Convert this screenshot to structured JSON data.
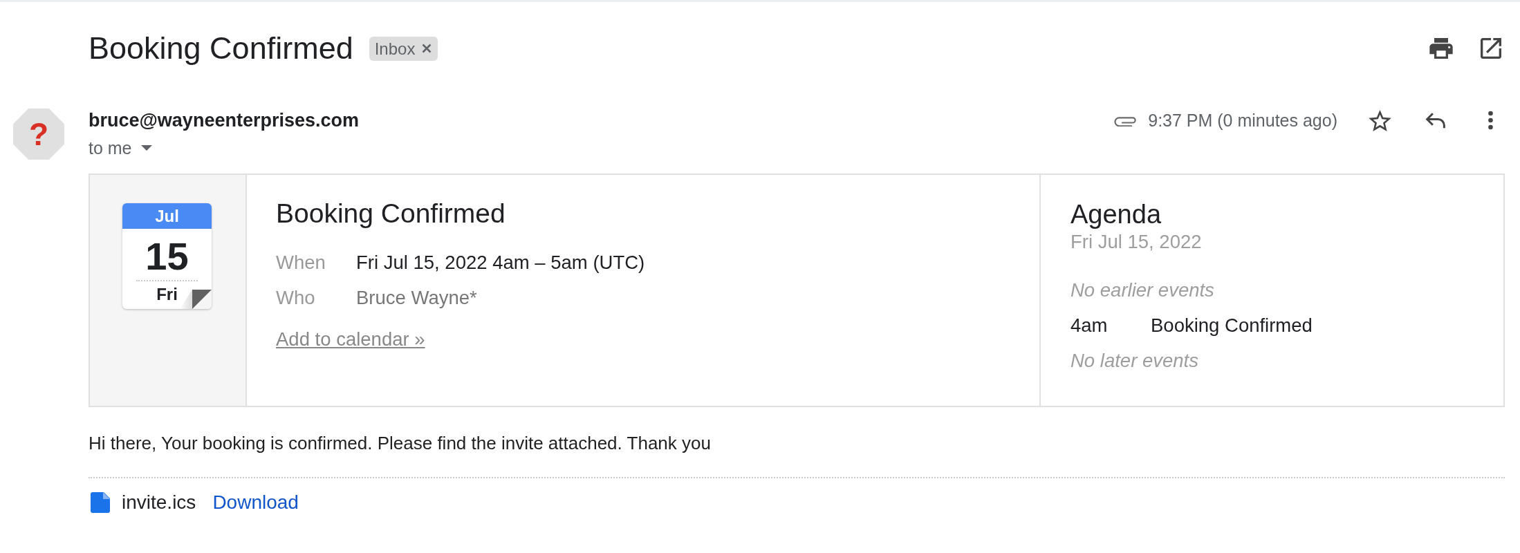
{
  "subject": {
    "title": "Booking Confirmed",
    "labels": [
      {
        "name": "Inbox"
      }
    ]
  },
  "message": {
    "avatar_glyph": "?",
    "sender": "bruce@wayneenterprises.com",
    "recipients": "to me",
    "time": "9:37 PM (0 minutes ago)",
    "starred": false
  },
  "invite": {
    "calendar": {
      "month": "Jul",
      "day": "15",
      "weekday": "Fri"
    },
    "title": "Booking Confirmed",
    "details": [
      {
        "kind": "time",
        "label": "When",
        "value": "Fri Jul 15, 2022 4am – 5am (UTC)"
      },
      {
        "kind": "guests",
        "label": "Who",
        "value": "Bruce Wayne*"
      }
    ],
    "link": "Add to calendar »",
    "agenda": {
      "title": "Agenda",
      "date": "Fri Jul 15, 2022",
      "entries": [
        {
          "kind": "note",
          "text": "No earlier events"
        },
        {
          "kind": "event",
          "time": "4am",
          "title": "Booking Confirmed"
        },
        {
          "kind": "note",
          "text": "No later events"
        }
      ]
    }
  },
  "body": {
    "text": "Hi there, Your booking is confirmed. Please find the invite attached. Thank you"
  },
  "attachments": [
    {
      "name": "invite.ics",
      "action": "Download"
    }
  ]
}
